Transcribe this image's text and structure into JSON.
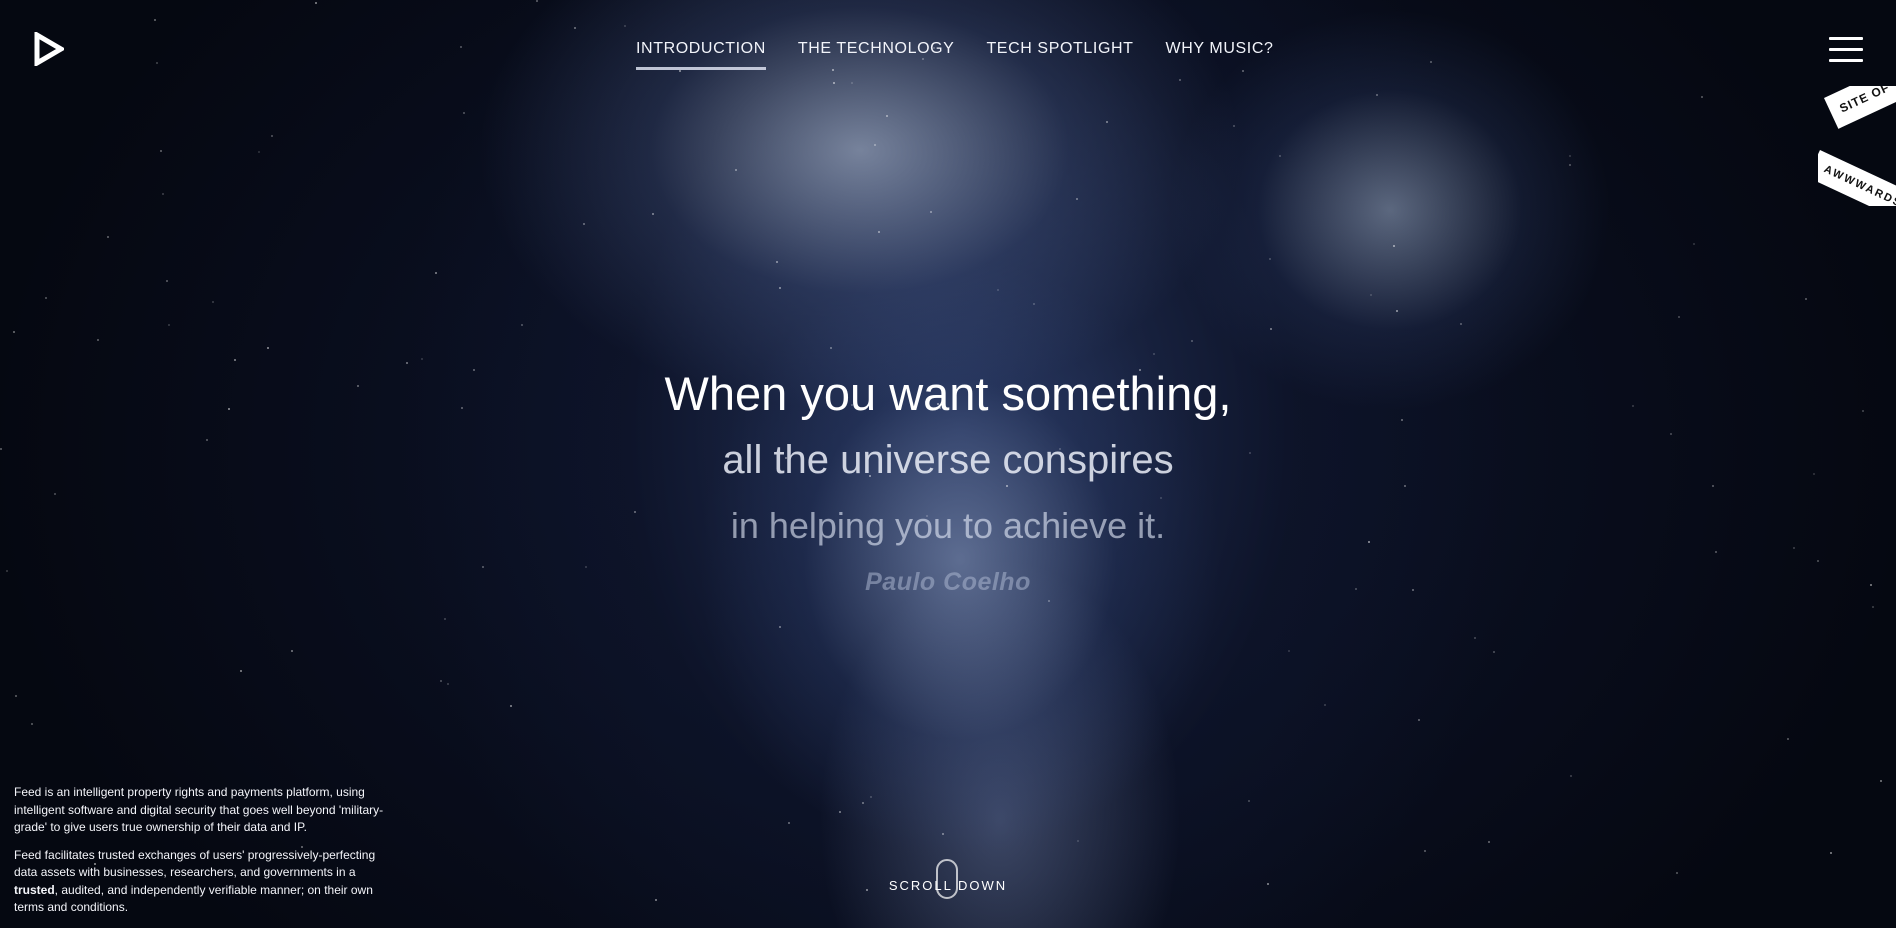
{
  "header": {
    "logo_icon": "play-triangle-icon",
    "nav": [
      {
        "label": "INTRODUCTION",
        "active": true
      },
      {
        "label": "THE TECHNOLOGY",
        "active": false
      },
      {
        "label": "TECH SPOTLIGHT",
        "active": false
      },
      {
        "label": "WHY MUSIC?",
        "active": false
      }
    ],
    "menu_icon": "hamburger-menu-icon"
  },
  "award": {
    "top": "SITE OF THE DAY",
    "bottom": "AWWWARDS"
  },
  "quote": {
    "line1": "When you want something,",
    "line2": "all the universe conspires",
    "line3": "in helping you to achieve it.",
    "author": "Paulo Coelho"
  },
  "about": {
    "paragraph1": "Feed is an intelligent property rights and payments platform, using intelligent software and digital security that goes well beyond 'military-grade' to give users true ownership of their data and IP.",
    "paragraph2_before": "Feed facilitates trusted exchanges of users' progressively-perfecting data assets with businesses, researchers, and governments in a ",
    "paragraph2_bold": "trusted",
    "paragraph2_after": ", audited, and independently verifiable manner; on their own terms and conditions."
  },
  "scroll": {
    "label": "SCROLL DOWN",
    "icon": "mouse-scroll-icon"
  },
  "colors": {
    "background": "#050811",
    "nebula": "#aebde0",
    "text": "#ffffff"
  }
}
